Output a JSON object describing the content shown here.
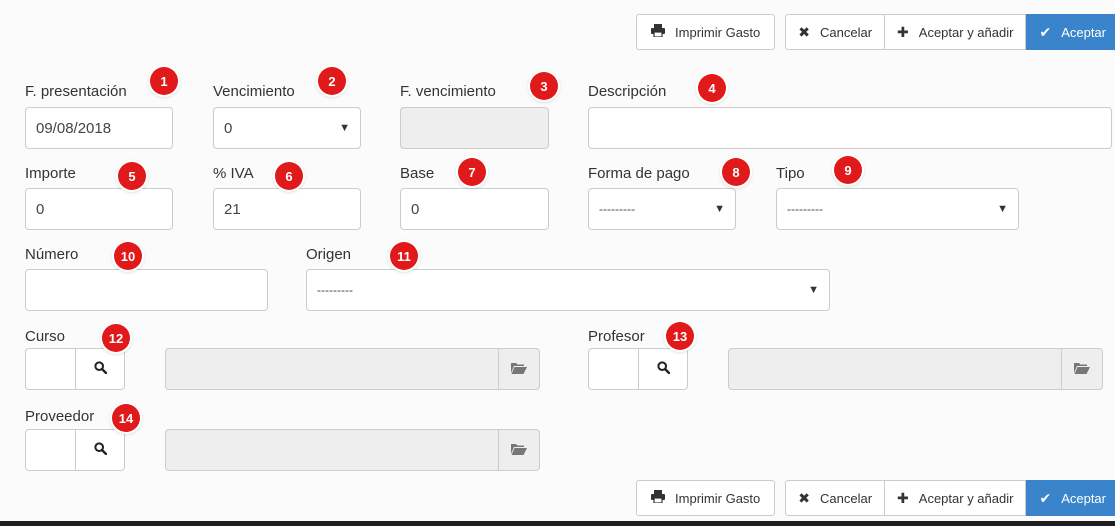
{
  "toolbar": {
    "print_label": "Imprimir Gasto",
    "cancel_label": "Cancelar",
    "add_accept_label": "Aceptar y añadir",
    "accept_label": "Aceptar",
    "accent_color": "#3a84cc"
  },
  "fields": {
    "f_presentacion": {
      "label": "F. presentación",
      "value": "09/08/2018"
    },
    "vencimiento": {
      "label": "Vencimiento",
      "value": "0"
    },
    "f_vencimiento": {
      "label": "F. vencimiento",
      "value": ""
    },
    "descripcion": {
      "label": "Descripción",
      "value": ""
    },
    "importe": {
      "label": "Importe",
      "value": "0"
    },
    "iva": {
      "label": "% IVA",
      "value": "21"
    },
    "base": {
      "label": "Base",
      "value": "0"
    },
    "forma_pago": {
      "label": "Forma de pago",
      "value": "---------"
    },
    "tipo": {
      "label": "Tipo",
      "value": "---------"
    },
    "numero": {
      "label": "Número",
      "value": ""
    },
    "origen": {
      "label": "Origen",
      "value": "---------"
    },
    "curso": {
      "label": "Curso"
    },
    "profesor": {
      "label": "Profesor"
    },
    "proveedor": {
      "label": "Proveedor"
    }
  },
  "badges": [
    "1",
    "2",
    "3",
    "4",
    "5",
    "6",
    "7",
    "8",
    "9",
    "10",
    "11",
    "12",
    "13",
    "14"
  ],
  "badge_color": "#e0191b",
  "icons": {
    "print": "printer-icon",
    "cancel": "x-icon",
    "add": "plus-icon",
    "accept": "check-icon",
    "search": "search-icon",
    "folder": "folder-open-icon"
  }
}
